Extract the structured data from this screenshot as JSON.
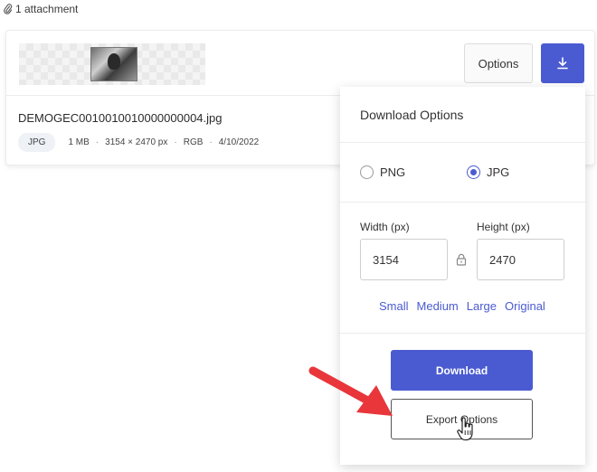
{
  "attachments": {
    "header": "1 attachment"
  },
  "file": {
    "name": "DEMOGEC0010010010000000004.jpg",
    "type_badge": "JPG",
    "size": "1 MB",
    "dimensions": "3154 × 2470 px",
    "color_mode": "RGB",
    "date": "4/10/2022"
  },
  "toolbar": {
    "options_label": "Options",
    "download_icon": "download-icon"
  },
  "download_panel": {
    "title": "Download Options",
    "formats": [
      {
        "label": "PNG",
        "selected": false
      },
      {
        "label": "JPG",
        "selected": true
      }
    ],
    "width_label": "Width (px)",
    "height_label": "Height (px)",
    "width_value": "3154",
    "height_value": "2470",
    "presets": [
      "Small",
      "Medium",
      "Large",
      "Original"
    ],
    "download_label": "Download",
    "export_label": "Export Options"
  },
  "colors": {
    "accent": "#4a5bd1",
    "annotation_arrow": "#e8363a"
  }
}
